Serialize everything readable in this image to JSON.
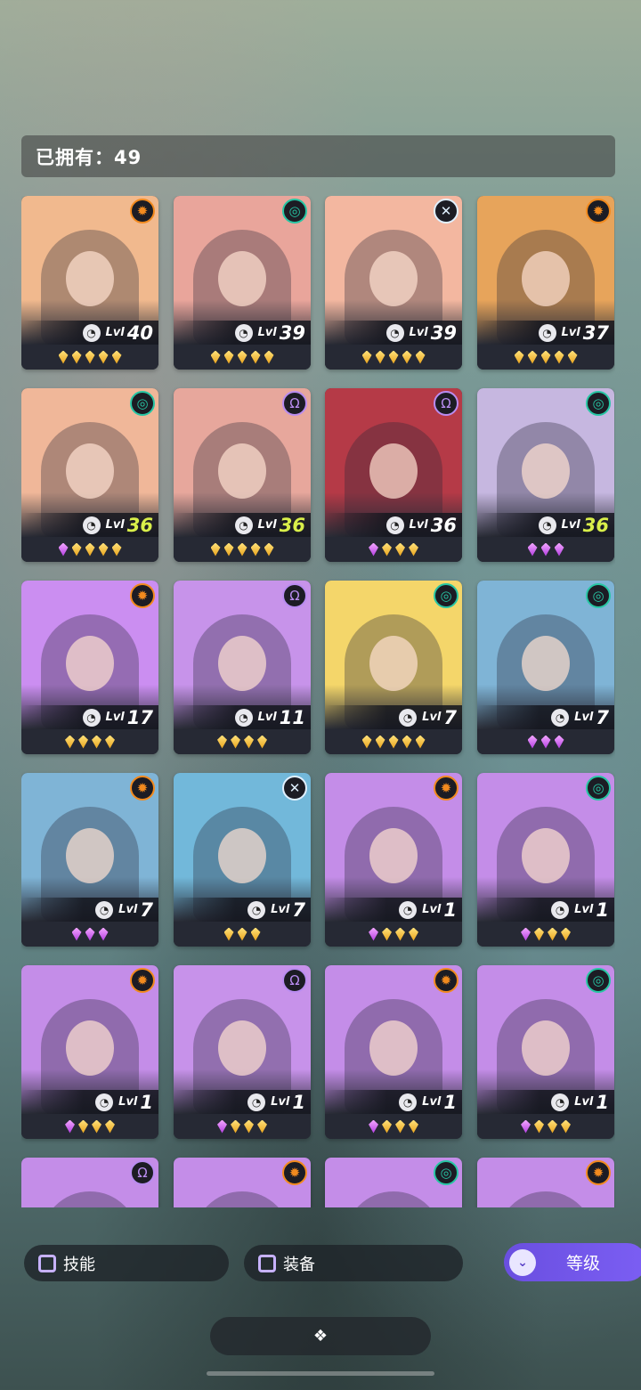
{
  "header": {
    "owned_label": "已拥有：49"
  },
  "filters": {
    "skill_label": "技能",
    "equip_label": "装备",
    "sort_label": "等级",
    "sort_icon": "double-chevron-down-icon"
  },
  "bottom": {
    "toggle_icon": "diamond-cluster-icon"
  },
  "level_prefix": "Lvl",
  "cards": [
    {
      "element": "sun",
      "level": "40",
      "stars": [
        "g",
        "g",
        "g",
        "g",
        "g"
      ],
      "bg": "#f1b98e"
    },
    {
      "element": "swirl",
      "level": "39",
      "stars": [
        "g",
        "g",
        "g",
        "g",
        "g"
      ],
      "bg": "#e9a59b"
    },
    {
      "element": "cross",
      "level": "39",
      "stars": [
        "g",
        "g",
        "g",
        "g",
        "g"
      ],
      "bg": "#f3b7a0"
    },
    {
      "element": "sun",
      "level": "37",
      "stars": [
        "g",
        "g",
        "g",
        "g",
        "g"
      ],
      "bg": "#e7a45b"
    },
    {
      "element": "swirl",
      "level": "36",
      "stars": [
        "p",
        "g",
        "g",
        "g",
        "g"
      ],
      "bg": "#f0b799",
      "hi": true
    },
    {
      "element": "omega",
      "level": "36",
      "stars": [
        "g",
        "g",
        "g",
        "g",
        "g"
      ],
      "bg": "#e7a79c",
      "hi": true
    },
    {
      "element": "omega",
      "level": "36",
      "stars": [
        "p",
        "g",
        "g",
        "g"
      ],
      "bg": "#b53a47"
    },
    {
      "element": "swirl",
      "level": "36",
      "stars": [
        "p",
        "p",
        "p"
      ],
      "bg": "#c6b7e0",
      "hi": true
    },
    {
      "element": "sun",
      "level": "17",
      "stars": [
        "g",
        "g",
        "g",
        "g"
      ],
      "bg": "#cb8ef1"
    },
    {
      "element": "omega",
      "level": "11",
      "stars": [
        "g",
        "g",
        "g",
        "g"
      ],
      "bg": "#c793ea"
    },
    {
      "element": "swirl",
      "level": "7",
      "stars": [
        "g",
        "g",
        "g",
        "g",
        "g"
      ],
      "bg": "#f4d66a"
    },
    {
      "element": "swirl",
      "level": "7",
      "stars": [
        "p",
        "p",
        "p"
      ],
      "bg": "#7fb4d6"
    },
    {
      "element": "sun",
      "level": "7",
      "stars": [
        "p",
        "p",
        "p"
      ],
      "bg": "#7fb4d6"
    },
    {
      "element": "cross",
      "level": "7",
      "stars": [
        "g",
        "g",
        "g"
      ],
      "bg": "#72b8da"
    },
    {
      "element": "sun",
      "level": "1",
      "stars": [
        "p",
        "g",
        "g",
        "g"
      ],
      "bg": "#c48de8"
    },
    {
      "element": "swirl",
      "level": "1",
      "stars": [
        "p",
        "g",
        "g",
        "g"
      ],
      "bg": "#c48de8"
    },
    {
      "element": "sun",
      "level": "1",
      "stars": [
        "p",
        "g",
        "g",
        "g"
      ],
      "bg": "#c48de8"
    },
    {
      "element": "omega",
      "level": "1",
      "stars": [
        "p",
        "g",
        "g",
        "g"
      ],
      "bg": "#c792ea"
    },
    {
      "element": "sun",
      "level": "1",
      "stars": [
        "p",
        "g",
        "g",
        "g"
      ],
      "bg": "#c48de8"
    },
    {
      "element": "swirl",
      "level": "1",
      "stars": [
        "p",
        "g",
        "g",
        "g"
      ],
      "bg": "#c48de8"
    },
    {
      "element": "omega",
      "level": "",
      "stars": [],
      "bg": "#c48de8"
    },
    {
      "element": "sun",
      "level": "",
      "stars": [],
      "bg": "#c48de8"
    },
    {
      "element": "swirl",
      "level": "",
      "stars": [],
      "bg": "#c48de8"
    },
    {
      "element": "sun",
      "level": "",
      "stars": [],
      "bg": "#c48de8"
    }
  ],
  "colors": {
    "element_sun": "#f28a1e",
    "element_swirl": "#27c6a4",
    "element_omega": "#b98cf0",
    "element_cross": "#e0f0ff",
    "level_highlight": "#d9ef4a"
  }
}
